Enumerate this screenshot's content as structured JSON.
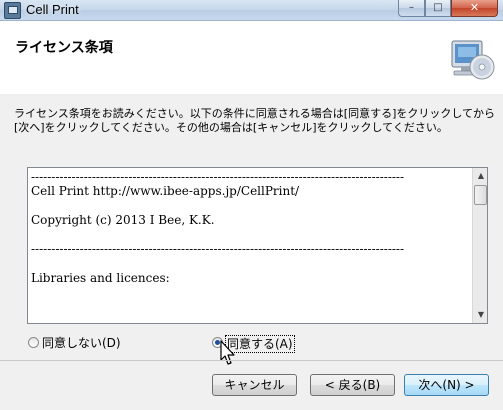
{
  "window": {
    "title": "Cell Print",
    "minimize_glyph": "–",
    "maximize_glyph": "□",
    "close_glyph": "✕"
  },
  "header": {
    "title": "ライセンス条項",
    "icon": "computer-cd-icon"
  },
  "instructions": "ライセンス条項をお読みください。以下の条件に同意される場合は[同意する]をクリックしてから[次へ]をクリックしてください。その他の場合は[キャンセル]をクリックしてください。",
  "license": {
    "lines": [
      "--------------------------------------------------------------------------------------------",
      "Cell Print http://www.ibee-apps.jp/CellPrint/",
      "",
      "Copyright (c) 2013 I Bee, K.K.",
      "",
      "--------------------------------------------------------------------------------------------",
      "",
      "Libraries and licences:"
    ],
    "scroll_up": "▲",
    "scroll_down": "▼"
  },
  "radios": {
    "decline_label": "同意しない(D)",
    "accept_label": "同意する(A)",
    "selected": "accept"
  },
  "buttons": {
    "cancel_label": "キャンセル",
    "back_label": "< 戻る(B)",
    "next_label": "次へ(N) >"
  },
  "colors": {
    "title_bar": "#c4d6ea",
    "close_button": "#c2432a",
    "next_button_border": "#3c7fb1"
  }
}
